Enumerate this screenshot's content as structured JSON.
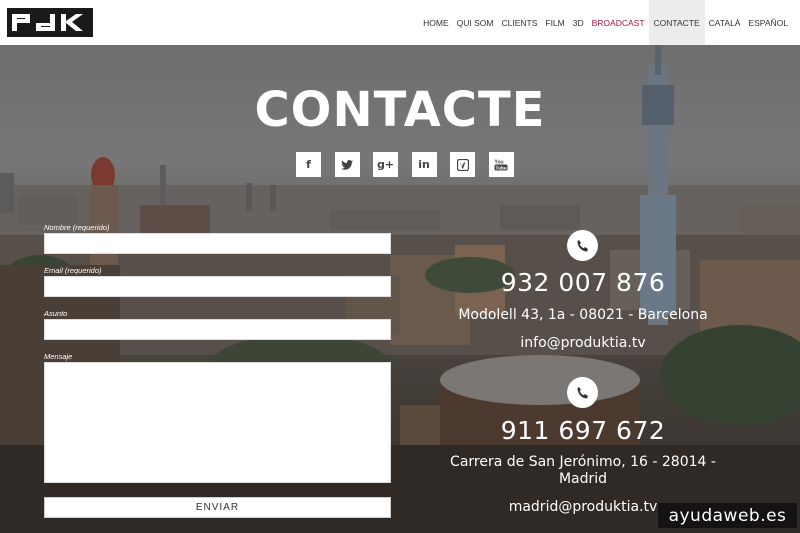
{
  "brand": {
    "logo_text": "PdK"
  },
  "nav": {
    "items": [
      {
        "label": "HOME"
      },
      {
        "label": "QUI SOM"
      },
      {
        "label": "CLIENTS"
      },
      {
        "label": "FILM"
      },
      {
        "label": "3D"
      },
      {
        "label": "BROADCAST"
      },
      {
        "label": "CONTACTE"
      },
      {
        "label": "CATALÀ"
      },
      {
        "label": "ESPAÑOL"
      }
    ],
    "active": "CONTACTE",
    "accent_color": "#a3154b"
  },
  "page_title": "CONTACTE",
  "social": [
    {
      "icon": "facebook-icon",
      "glyph": "f"
    },
    {
      "icon": "twitter-icon",
      "glyph": "t"
    },
    {
      "icon": "google-plus-icon",
      "glyph": "g+"
    },
    {
      "icon": "linkedin-icon",
      "glyph": "in"
    },
    {
      "icon": "vimeo-icon",
      "glyph": "v"
    },
    {
      "icon": "youtube-icon",
      "glyph": "You"
    }
  ],
  "form": {
    "name_label": "Nombre (requerido)",
    "email_label": "Email (requerido)",
    "subject_label": "Asunto",
    "message_label": "Mensaje",
    "submit_label": "ENVIAR"
  },
  "offices": [
    {
      "phone": "932 007 876",
      "address": "Modolell 43, 1a - 08021 - Barcelona",
      "email": "info@produktia.tv"
    },
    {
      "phone": "911 697 672",
      "address": "Carrera de San Jerónimo, 16 - 28014 - Madrid",
      "email": "madrid@produktia.tv"
    }
  ],
  "watermark": "ayudaweb.es"
}
